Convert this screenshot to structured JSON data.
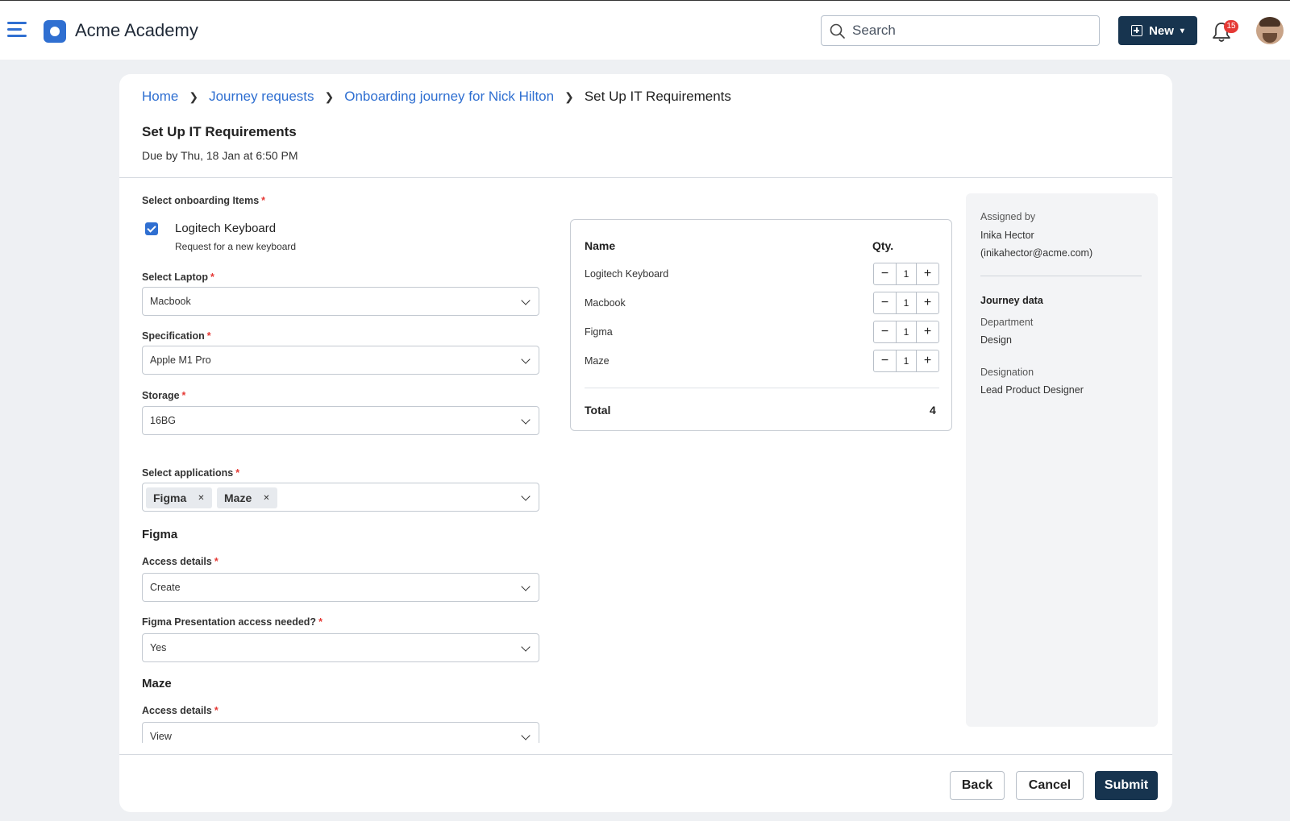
{
  "app": {
    "title": "Acme Academy"
  },
  "header": {
    "search_placeholder": "Search",
    "new_label": "New",
    "notification_count": "15"
  },
  "breadcrumb": [
    "Home",
    "Journey requests",
    "Onboarding journey for Nick Hilton",
    "Set Up IT Requirements"
  ],
  "page": {
    "title": "Set Up IT Requirements",
    "due": "Due by Thu, 18 Jan at 6:50 PM"
  },
  "form": {
    "onboarding_label": "Select onboarding Items",
    "onboarding_item": {
      "title": "Logitech Keyboard",
      "subtitle": "Request for a new keyboard",
      "checked": true
    },
    "laptop_label": "Select Laptop",
    "laptop_value": "Macbook",
    "spec_label": "Specification",
    "spec_value": "Apple M1 Pro",
    "storage_label": "Storage",
    "storage_value": "16BG",
    "apps_label": "Select applications",
    "apps_chips": [
      "Figma",
      "Maze"
    ],
    "figma_heading": "Figma",
    "figma_access_label": "Access details",
    "figma_access_value": "Create",
    "figma_pres_label": "Figma Presentation access needed?",
    "figma_pres_value": "Yes",
    "maze_heading": "Maze",
    "maze_access_label": "Access details",
    "maze_access_value": "View",
    "required_mark": "*"
  },
  "summary": {
    "col_name": "Name",
    "col_qty": "Qty.",
    "rows": [
      {
        "name": "Logitech Keyboard",
        "qty": "1"
      },
      {
        "name": "Macbook",
        "qty": "1"
      },
      {
        "name": "Figma",
        "qty": "1"
      },
      {
        "name": "Maze",
        "qty": "1"
      }
    ],
    "minus": "−",
    "plus": "+",
    "total_label": "Total",
    "total_value": "4"
  },
  "sidebar": {
    "assigned_by_label": "Assigned by",
    "assigned_by_name": "Inika Hector",
    "assigned_by_email": "(inikahector@acme.com)",
    "journey_heading": "Journey data",
    "department_label": "Department",
    "department_value": "Design",
    "designation_label": "Designation",
    "designation_value": "Lead Product Designer"
  },
  "actions": {
    "back": "Back",
    "cancel": "Cancel",
    "submit": "Submit"
  },
  "colors": {
    "accent": "#2f6fd1",
    "primary": "#17344f",
    "danger": "#e53935"
  }
}
